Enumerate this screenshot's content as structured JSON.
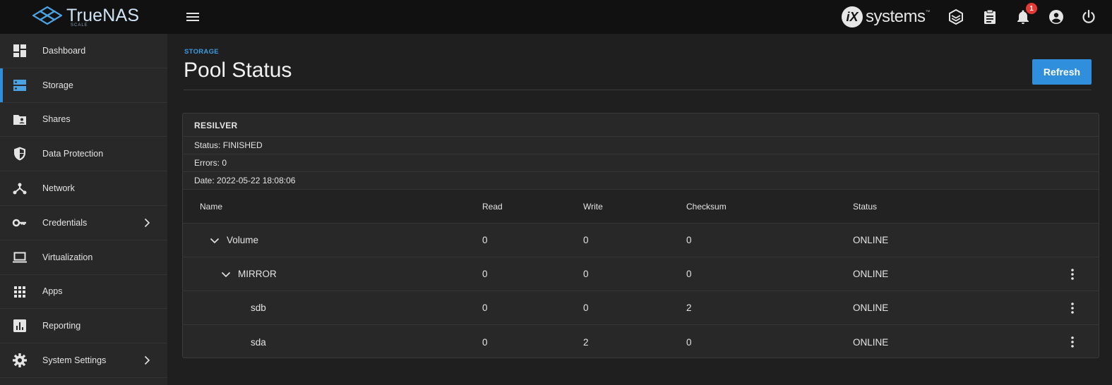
{
  "app": {
    "logo_text": "TrueNAS",
    "logo_sub": "SCALE",
    "vendor": "systems",
    "vendor_initial": "iX"
  },
  "topbar": {
    "notification_count": "1"
  },
  "sidebar": {
    "items": [
      {
        "label": "Dashboard",
        "icon": "dashboard-icon"
      },
      {
        "label": "Storage",
        "icon": "storage-icon",
        "active": true
      },
      {
        "label": "Shares",
        "icon": "shares-folder-icon"
      },
      {
        "label": "Data Protection",
        "icon": "shield-icon"
      },
      {
        "label": "Network",
        "icon": "network-icon"
      },
      {
        "label": "Credentials",
        "icon": "key-icon",
        "has_children": true
      },
      {
        "label": "Virtualization",
        "icon": "laptop-icon"
      },
      {
        "label": "Apps",
        "icon": "apps-grid-icon"
      },
      {
        "label": "Reporting",
        "icon": "reporting-icon"
      },
      {
        "label": "System Settings",
        "icon": "gear-icon",
        "has_children": true
      }
    ]
  },
  "page": {
    "breadcrumb": "STORAGE",
    "title": "Pool Status",
    "refresh_label": "Refresh"
  },
  "resilver": {
    "heading": "RESILVER",
    "status": "Status: FINISHED",
    "errors": "Errors: 0",
    "date": "Date: 2022-05-22 18:08:06"
  },
  "table": {
    "columns": [
      "Name",
      "Read",
      "Write",
      "Checksum",
      "Status"
    ],
    "rows": [
      {
        "name": "Volume",
        "read": "0",
        "write": "0",
        "checksum": "0",
        "status": "ONLINE"
      },
      {
        "name": "MIRROR",
        "read": "0",
        "write": "0",
        "checksum": "0",
        "status": "ONLINE"
      },
      {
        "name": "sdb",
        "read": "0",
        "write": "0",
        "checksum": "2",
        "status": "ONLINE"
      },
      {
        "name": "sda",
        "read": "0",
        "write": "2",
        "checksum": "0",
        "status": "ONLINE"
      }
    ]
  },
  "colors": {
    "accent": "#2f8fdd",
    "background": "#1f1f1f",
    "sidebar": "#282828",
    "topbar": "#111111",
    "badge": "#e53935"
  }
}
